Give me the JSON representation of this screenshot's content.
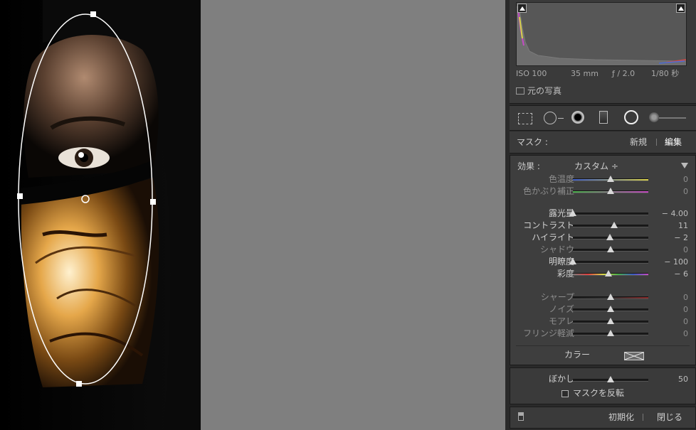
{
  "histogram": {
    "iso": "ISO 100",
    "focal": "35 mm",
    "aperture": "ƒ / 2.0",
    "shutter": "1/80 秒",
    "original_photo_label": "元の写真"
  },
  "tools": [
    "crop-overlay-icon",
    "spot-removal-icon",
    "red-eye-icon",
    "graduated-filter-icon",
    "radial-filter-icon",
    "adjustment-brush-icon"
  ],
  "mask_header": {
    "label": "マスク :",
    "new": "新規",
    "edit": "編集"
  },
  "effect": {
    "label": "効果 :",
    "preset": "カスタム ÷"
  },
  "sliders_wb": [
    {
      "label": "色温度",
      "value": "0",
      "pos": 0.5,
      "gradient": "linear-gradient(90deg,#3d5cc4,#d8d04a)"
    },
    {
      "label": "色かぶり補正",
      "value": "0",
      "pos": 0.5,
      "gradient": "linear-gradient(90deg,#49b04a,#c64ac2)"
    }
  ],
  "sliders_tone": [
    {
      "label": "露光量",
      "value": "− 4.00",
      "pos": 0.0
    },
    {
      "label": "コントラスト",
      "value": "11",
      "pos": 0.55
    },
    {
      "label": "ハイライト",
      "value": "− 2",
      "pos": 0.49
    },
    {
      "label": "シャドウ",
      "value": "0",
      "pos": 0.5
    },
    {
      "label": "明瞭度",
      "value": "− 100",
      "pos": 0.0
    },
    {
      "label": "彩度",
      "value": "− 6",
      "pos": 0.47,
      "gradient": "linear-gradient(90deg,#7a7a7a,#e04040,#d8d84a,#49b04a,#3d5cc4,#c64ac2)"
    }
  ],
  "sliders_detail": [
    {
      "label": "シャープ",
      "value": "0",
      "pos": 0.5,
      "gradient": "linear-gradient(90deg,#1a1a1a,#2a2a2a,#8a2a2a)"
    },
    {
      "label": "ノイズ",
      "value": "0",
      "pos": 0.5
    },
    {
      "label": "モアレ",
      "value": "0",
      "pos": 0.5
    },
    {
      "label": "フリンジ軽減",
      "value": "0",
      "pos": 0.5
    }
  ],
  "color": {
    "label": "カラー"
  },
  "feather": {
    "label": "ぼかし",
    "value": "50",
    "pos": 0.5
  },
  "invert_mask": {
    "label": "マスクを反転",
    "checked": false
  },
  "footer": {
    "reset": "初期化",
    "close": "閉じる"
  }
}
